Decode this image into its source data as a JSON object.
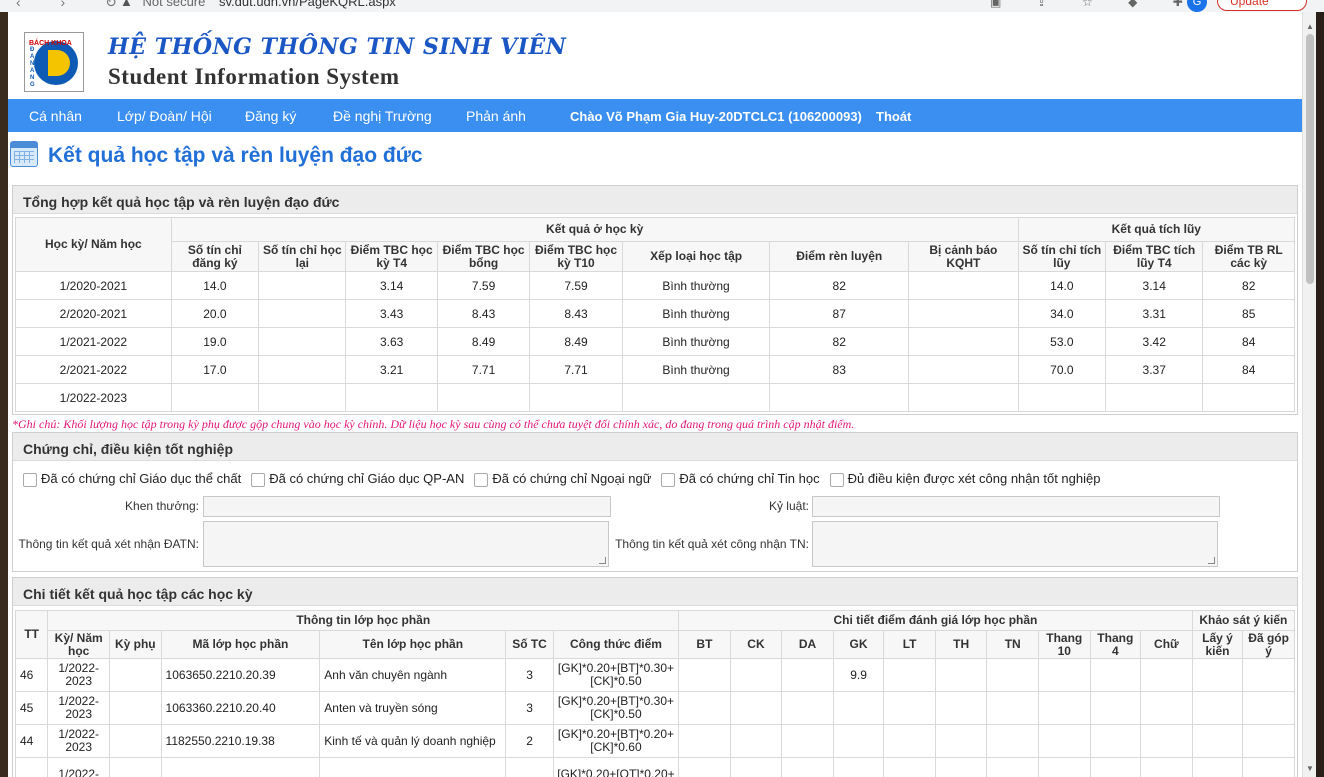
{
  "browser": {
    "not_secure": "Not secure",
    "url": "sv.dut.udn.vn/PageKQRL.aspx",
    "update_label": "Update",
    "avatar_letter": "G"
  },
  "header": {
    "logo_text": "BÁCH KHOA",
    "logo_side": "ĐÀ NẴNG",
    "title_vn": "HỆ THỐNG THÔNG TIN SINH VIÊN",
    "title_en": "Student Information System"
  },
  "nav": {
    "items": [
      "Cá nhân",
      "Lớp/ Đoàn/ Hội",
      "Đăng ký",
      "Đề nghị Trường",
      "Phản ánh"
    ],
    "greeting": "Chào Võ Phạm Gia Huy-20DTCLC1 (106200093)",
    "logout": "Thoát"
  },
  "page_title": "Kết quả học tập và rèn luyện đạo đức",
  "summary": {
    "heading": "Tổng hợp kết quả học tập và rèn luyện đạo đức",
    "group_term": "Kết quả ở học kỳ",
    "group_cum": "Kết quả tích lũy",
    "col_term": "Học kỳ/ Năm học",
    "columns": [
      "Số tín chỉ đăng ký",
      "Số tín chỉ học lại",
      "Điểm TBC học kỳ T4",
      "Điểm TBC học bổng",
      "Điểm TBC học kỳ T10",
      "Xếp loại học tập",
      "Điểm rèn luyện",
      "Bị cảnh báo KQHT",
      "Số tín chỉ tích lũy",
      "Điểm TBC tích lũy T4",
      "Điểm TB RL các kỳ"
    ],
    "rows": [
      [
        "1/2020-2021",
        "14.0",
        "",
        "3.14",
        "7.59",
        "7.59",
        "Bình thường",
        "82",
        "",
        "14.0",
        "3.14",
        "82"
      ],
      [
        "2/2020-2021",
        "20.0",
        "",
        "3.43",
        "8.43",
        "8.43",
        "Bình thường",
        "87",
        "",
        "34.0",
        "3.31",
        "85"
      ],
      [
        "1/2021-2022",
        "19.0",
        "",
        "3.63",
        "8.49",
        "8.49",
        "Bình thường",
        "82",
        "",
        "53.0",
        "3.42",
        "84"
      ],
      [
        "2/2021-2022",
        "17.0",
        "",
        "3.21",
        "7.71",
        "7.71",
        "Bình thường",
        "83",
        "",
        "70.0",
        "3.37",
        "84"
      ],
      [
        "1/2022-2023",
        "",
        "",
        "",
        "",
        "",
        "",
        "",
        "",
        "",
        "",
        ""
      ]
    ]
  },
  "note": "*Ghi chú: Khối lượng học tập trong kỳ phụ được gộp chung vào học kỳ chính. Dữ liệu học kỳ sau cùng có thể chưa tuyệt đối chính xác, do đang trong quá trình cập nhật điểm.",
  "certs": {
    "heading": "Chứng chỉ, điều kiện tốt nghiệp",
    "checkboxes": [
      "Đã có chứng chỉ Giáo dục thể chất",
      "Đã có chứng chỉ Giáo dục QP-AN",
      "Đã có chứng chỉ Ngoại ngữ",
      "Đã có chứng chỉ Tin học",
      "Đủ điều kiện được xét công nhận tốt nghiệp"
    ],
    "reward_label": "Khen thưởng:",
    "discipline_label": "Kỷ luật:",
    "datn_label": "Thông tin kết quả xét nhận ĐATN:",
    "tn_label": "Thông tin kết quả xét công nhận TN:"
  },
  "detail": {
    "heading": "Chi tiết kết quả học tập các học kỳ",
    "col_tt": "TT",
    "group_info": "Thông tin lớp học phần",
    "group_scores": "Chi tiết điểm đánh giá lớp học phần",
    "group_survey": "Khảo sát ý kiến",
    "columns": [
      "Kỳ/ Năm học",
      "Kỳ phụ",
      "Mã lớp học phần",
      "Tên lớp học phần",
      "Số TC",
      "Công thức điểm",
      "BT",
      "CK",
      "DA",
      "GK",
      "LT",
      "TH",
      "TN",
      "Thang 10",
      "Thang 4",
      "Chữ",
      "Lấy ý kiến",
      "Đã góp ý"
    ],
    "rows": [
      [
        "46",
        "1/2022-2023",
        "",
        "1063650.2210.20.39",
        "Anh văn chuyên ngành",
        "3",
        "[GK]*0.20+[BT]*0.30+[CK]*0.50",
        "",
        "",
        "",
        "9.9",
        "",
        "",
        "",
        "",
        "",
        "",
        "",
        ""
      ],
      [
        "45",
        "1/2022-2023",
        "",
        "1063360.2210.20.40",
        "Anten và truyền sóng",
        "3",
        "[GK]*0.20+[BT]*0.30+[CK]*0.50",
        "",
        "",
        "",
        "",
        "",
        "",
        "",
        "",
        "",
        "",
        "",
        ""
      ],
      [
        "44",
        "1/2022-2023",
        "",
        "1182550.2210.19.38",
        "Kinh tế và quản lý doanh nghiệp",
        "2",
        "[GK]*0.20+[BT]*0.20+[CK]*0.60",
        "",
        "",
        "",
        "",
        "",
        "",
        "",
        "",
        "",
        "",
        "",
        ""
      ],
      [
        "",
        "1/2022-",
        "",
        "",
        "",
        "",
        "[GK]*0.20+[QT]*0.20+",
        "",
        "",
        "",
        "",
        "",
        "",
        "",
        "",
        "",
        "",
        "",
        ""
      ]
    ]
  }
}
